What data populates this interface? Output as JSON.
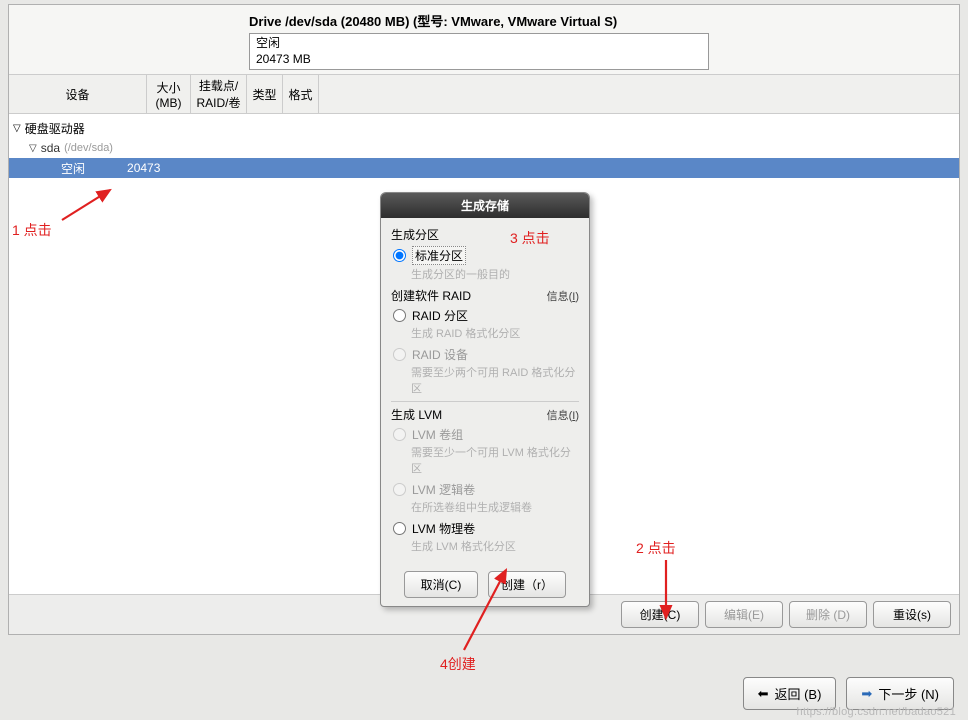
{
  "drive": {
    "title": "Drive /dev/sda (20480 MB) (型号: VMware, VMware Virtual S)",
    "box_line1": "空闲",
    "box_line2": "20473 MB"
  },
  "columns": {
    "device": "设备",
    "size": "大小\n(MB)",
    "mount": "挂载点/\nRAID/卷",
    "type": "类型",
    "format": "格式"
  },
  "tree": {
    "root": "硬盘驱动器",
    "sda_name": "sda",
    "sda_path": "(/dev/sda)",
    "free_label": "空闲",
    "free_size": "20473"
  },
  "buttons": {
    "create": "创建(C)",
    "edit": "编辑(E)",
    "delete": "删除 (D)",
    "reset": "重设(s)"
  },
  "nav": {
    "back": "返回 (B)",
    "next": "下一步 (N)"
  },
  "dialog": {
    "title": "生成存储",
    "sect_partition": "生成分区",
    "opt_standard": "标准分区",
    "hint_standard": "生成分区的一般目的",
    "sect_raid": "创建软件 RAID",
    "info_raid": "信息(I)",
    "opt_raid_part": "RAID 分区",
    "hint_raid_part": "生成 RAID 格式化分区",
    "opt_raid_dev": "RAID 设备",
    "hint_raid_dev": "需要至少两个可用 RAID 格式化分区",
    "sect_lvm": "生成 LVM",
    "info_lvm": "信息(I)",
    "opt_lvm_vg": "LVM 卷组",
    "hint_lvm_vg": "需要至少一个可用 LVM 格式化分区",
    "opt_lvm_lv": "LVM 逻辑卷",
    "hint_lvm_lv": "在所选卷组中生成逻辑卷",
    "opt_lvm_pv": "LVM 物理卷",
    "hint_lvm_pv": "生成 LVM 格式化分区",
    "cancel": "取消(C)",
    "create": "创建（r）"
  },
  "annotations": {
    "a1": "1 点击",
    "a2": "2 点击",
    "a3": "3  点击",
    "a4": "4创建"
  },
  "watermark": "https://blog.csdn.net/badao521"
}
